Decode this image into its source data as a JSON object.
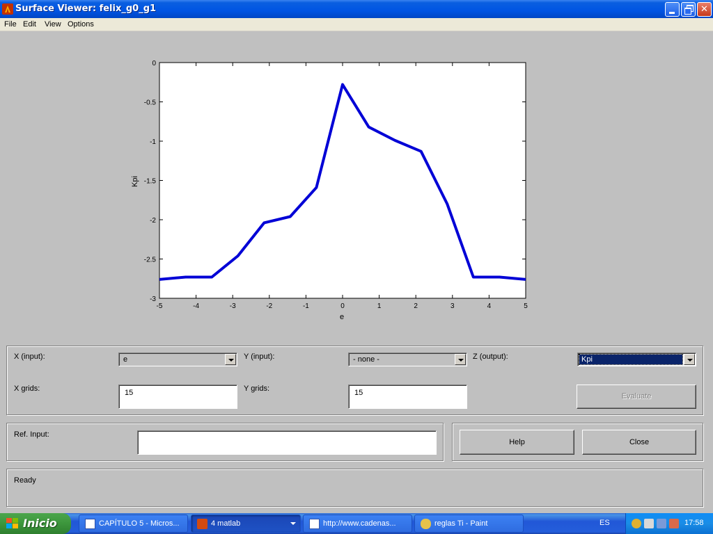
{
  "window": {
    "title": "Surface Viewer: felix_g0_g1"
  },
  "menu": [
    "File",
    "Edit",
    "View",
    "Options"
  ],
  "chart_data": {
    "type": "line",
    "xlabel": "e",
    "ylabel": "Kpi",
    "xlim": [
      -5,
      5
    ],
    "ylim": [
      -3,
      0
    ],
    "xticks": [
      -5,
      -4,
      -3,
      -2,
      -1,
      0,
      1,
      2,
      3,
      4,
      5
    ],
    "yticks": [
      0,
      -0.5,
      -1,
      -1.5,
      -2,
      -2.5,
      -3
    ],
    "ytick_labels": [
      "0",
      "-0.5",
      "-1",
      "-1.5",
      "-2",
      "-2.5",
      "-3"
    ],
    "grid": false,
    "series_color": "#0000d6",
    "x": [
      -5,
      -4.286,
      -3.571,
      -2.857,
      -2.143,
      -1.429,
      -0.714,
      0,
      0.714,
      1.429,
      2.143,
      2.857,
      3.571,
      4.286,
      5
    ],
    "y": [
      -2.76,
      -2.73,
      -2.73,
      -2.46,
      -2.04,
      -1.96,
      -1.59,
      -0.28,
      -0.82,
      -0.99,
      -1.13,
      -1.8,
      -2.73,
      -2.73,
      -2.76
    ]
  },
  "controls": {
    "x_input_label": "X (input):",
    "x_input_value": "e",
    "y_input_label": "Y (input):",
    "y_input_value": "- none -",
    "z_output_label": "Z (output):",
    "z_output_value": "Kpi",
    "x_grids_label": "X grids:",
    "x_grids_value": "15",
    "y_grids_label": "Y grids:",
    "y_grids_value": "15",
    "evaluate_label": "Evaluate",
    "ref_input_label": "Ref. Input:",
    "ref_input_value": "",
    "help_label": "Help",
    "close_label": "Close"
  },
  "status": {
    "text": "Ready"
  },
  "taskbar": {
    "start_label": "Inicio",
    "tasks": [
      {
        "label": "CAPÍTULO 5 - Micros...",
        "icon": "word-icon"
      },
      {
        "label": "4 matlab",
        "icon": "matlab-icon"
      },
      {
        "label": "http://www.cadenas...",
        "icon": "browser-icon"
      },
      {
        "label": "reglas Ti - Paint",
        "icon": "paint-icon"
      }
    ],
    "language": "ES",
    "clock": "17:58"
  }
}
